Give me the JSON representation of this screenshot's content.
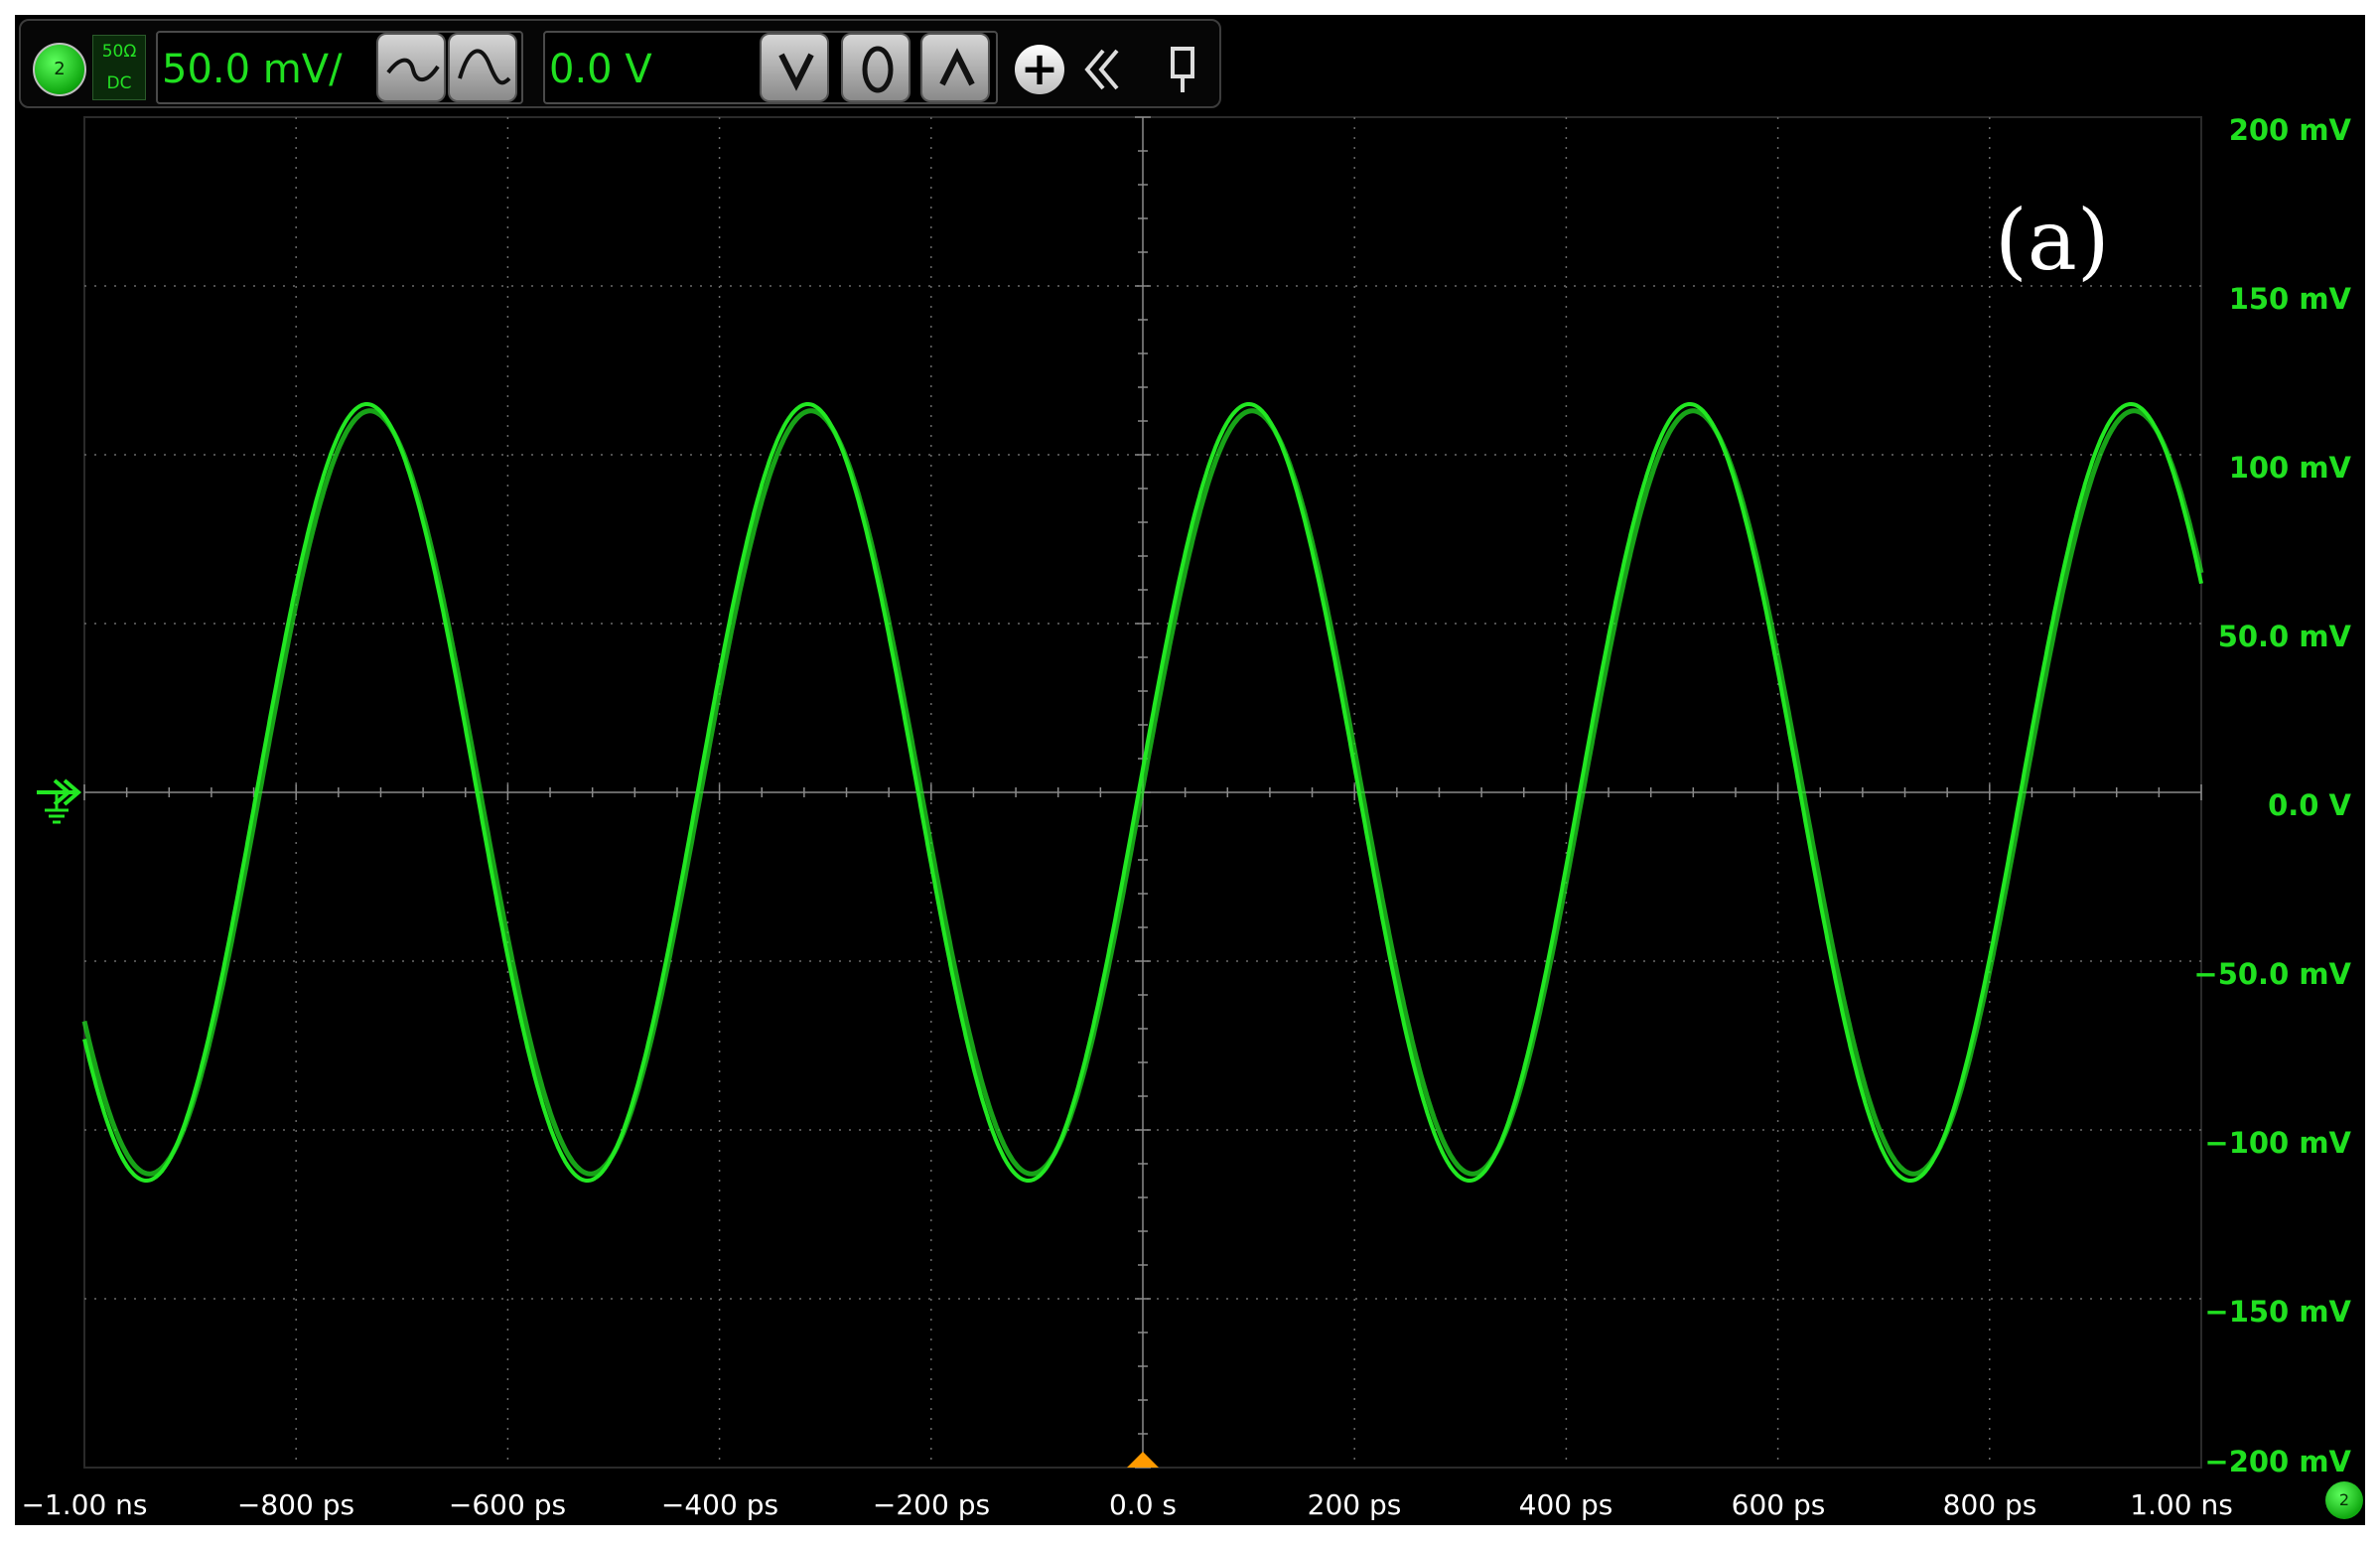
{
  "channel": {
    "number": "2",
    "impedance": "50Ω",
    "coupling": "DC",
    "scale": "50.0 mV/",
    "offset": "0.0 V"
  },
  "annotation": "(a)",
  "colors": {
    "trace": "#22e822",
    "grid": "#6a6a6a",
    "trigger_marker": "#ff9a00",
    "background": "#000000"
  },
  "toolbar_icons": [
    "coupling-badge",
    "ac-filter-icon",
    "bandwidth-filter-icon",
    "slope-down-icon",
    "circle-icon",
    "slope-up-icon",
    "add-icon",
    "collapse-icon",
    "pin-icon"
  ],
  "chart_data": {
    "type": "line",
    "y_tick_labels": [
      "200 mV",
      "150 mV",
      "100 mV",
      "50.0 mV",
      "0.0 V",
      "−50.0 mV",
      "−100 mV",
      "−150 mV",
      "−200 mV"
    ],
    "x_tick_labels": [
      "−1.00 ns",
      "−800 ps",
      "−600 ps",
      "−400 ps",
      "−200 ps",
      "0.0 s",
      "200 ps",
      "400 ps",
      "600 ps",
      "800 ps",
      "1.00 ns"
    ],
    "xlim_ps": [
      -1000,
      1000
    ],
    "ylim_mV": [
      -200,
      200
    ],
    "grid": true,
    "series": [
      {
        "amplitude_mV": 115,
        "frequency_GHz": 2.4,
        "phase_zero_crossing_ps": -4
      }
    ],
    "trigger_time_ps": 0
  }
}
